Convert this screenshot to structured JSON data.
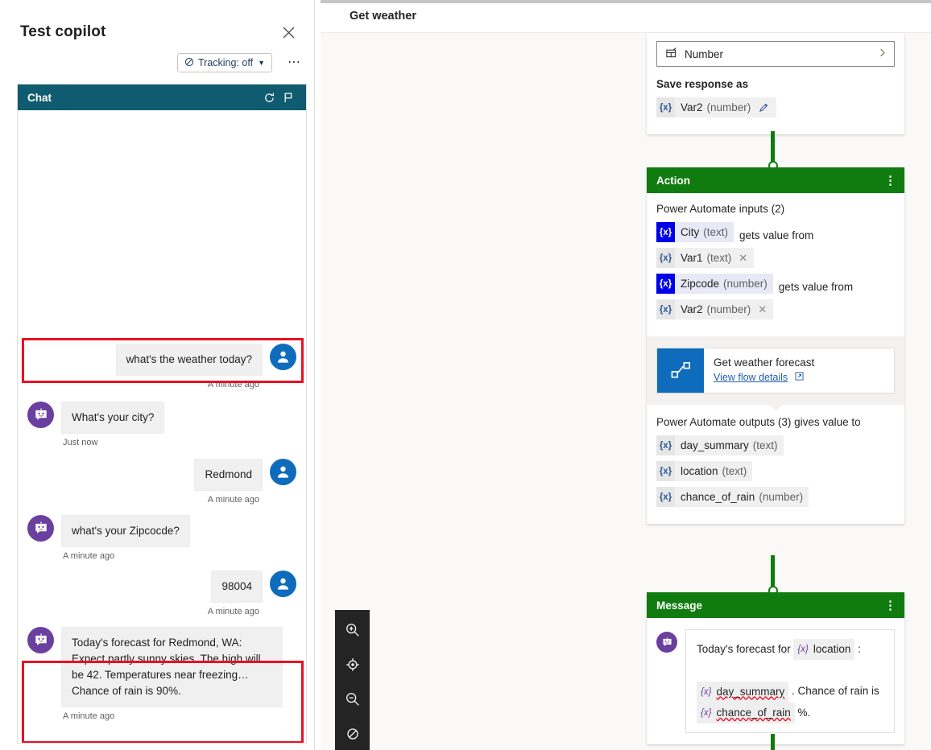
{
  "test_panel": {
    "title": "Test copilot",
    "close_icon": "close-icon",
    "tracking_label": "Tracking: off",
    "more_label": "⋯",
    "chat_header": {
      "title": "Chat",
      "refresh_icon": "refresh-icon",
      "flag_icon": "flag-icon"
    },
    "messages": [
      {
        "sender": "user",
        "text": "what's the weather today?",
        "timestamp": "A minute ago",
        "highlighted": true
      },
      {
        "sender": "bot",
        "text": "What's your city?",
        "timestamp": "Just now",
        "highlighted": false
      },
      {
        "sender": "user",
        "text": "Redmond",
        "timestamp": "A minute ago",
        "highlighted": false
      },
      {
        "sender": "bot",
        "text": "what's your Zipcocde?",
        "timestamp": "A minute ago",
        "highlighted": false
      },
      {
        "sender": "user",
        "text": "98004",
        "timestamp": "A minute ago",
        "highlighted": false
      },
      {
        "sender": "bot",
        "text": "Today's forecast for Redmond, WA: Expect partly sunny skies. The high will be 42. Temperatures near freezing… Chance of rain is 90%.",
        "timestamp": "A minute ago",
        "highlighted": true
      }
    ]
  },
  "canvas": {
    "header_title": "Get weather",
    "zoom_controls": [
      {
        "name": "zoom-in-icon",
        "label": "Zoom in"
      },
      {
        "name": "fit-to-screen-icon",
        "label": "Fit to screen"
      },
      {
        "name": "zoom-out-icon",
        "label": "Zoom out"
      },
      {
        "name": "reset-zoom-icon",
        "label": "Reset zoom"
      }
    ]
  },
  "question_node": {
    "identity_select": {
      "icon": "entity-icon",
      "label": "Number",
      "chevron": "›"
    },
    "save_response_label": "Save response as",
    "variable": {
      "badge": "{x}",
      "name": "Var2",
      "type": "(number)",
      "edit_icon": "pencil-icon"
    }
  },
  "action_node": {
    "title": "Action",
    "kebab": "⋮",
    "status_icon": "check-circle-icon",
    "inputs_label": "Power Automate inputs (2)",
    "inputs": [
      {
        "param": {
          "badge": "{x}",
          "name": "City",
          "type": "(text)"
        },
        "connector_text": "gets value from",
        "value": {
          "badge": "{x}",
          "name": "Var1",
          "type": "(text)",
          "remove": "✕"
        }
      },
      {
        "param": {
          "badge": "{x}",
          "name": "Zipcode",
          "type": "(number)"
        },
        "connector_text": "gets value from",
        "value": {
          "badge": "{x}",
          "name": "Var2",
          "type": "(number)",
          "remove": "✕"
        }
      }
    ],
    "flow_card": {
      "icon": "power-automate-icon",
      "name": "Get weather forecast",
      "link_label": "View flow details",
      "link_icon": "external-link-icon"
    },
    "outputs_label": "Power Automate outputs (3) gives value to",
    "outputs": [
      {
        "badge": "{x}",
        "name": "day_summary",
        "type": "(text)"
      },
      {
        "badge": "{x}",
        "name": "location",
        "type": "(text)"
      },
      {
        "badge": "{x}",
        "name": "chance_of_rain",
        "type": "(number)"
      }
    ]
  },
  "message_node": {
    "title": "Message",
    "kebab": "⋮",
    "status_icon": "check-circle-icon",
    "bot_icon": "bot-avatar-icon",
    "text_before": "Today's forecast for",
    "var_location": {
      "badge": "{x}",
      "name": "location"
    },
    "text_colon": ":",
    "var_day_summary": {
      "badge": "{x}",
      "name": "day_summary"
    },
    "text_middle": ". Chance of rain is",
    "var_chance_of_rain": {
      "badge": "{x}",
      "name": "chance_of_rain"
    },
    "text_end": "%."
  },
  "colors": {
    "chat_header": "#0f5b70",
    "node_green": "#107c10",
    "user_avatar": "#0f6cbd",
    "bot_avatar": "#6b3fa0",
    "highlight": "#e81123",
    "param_badge": "#0000e8",
    "flow_icon": "#0f6cbd"
  }
}
